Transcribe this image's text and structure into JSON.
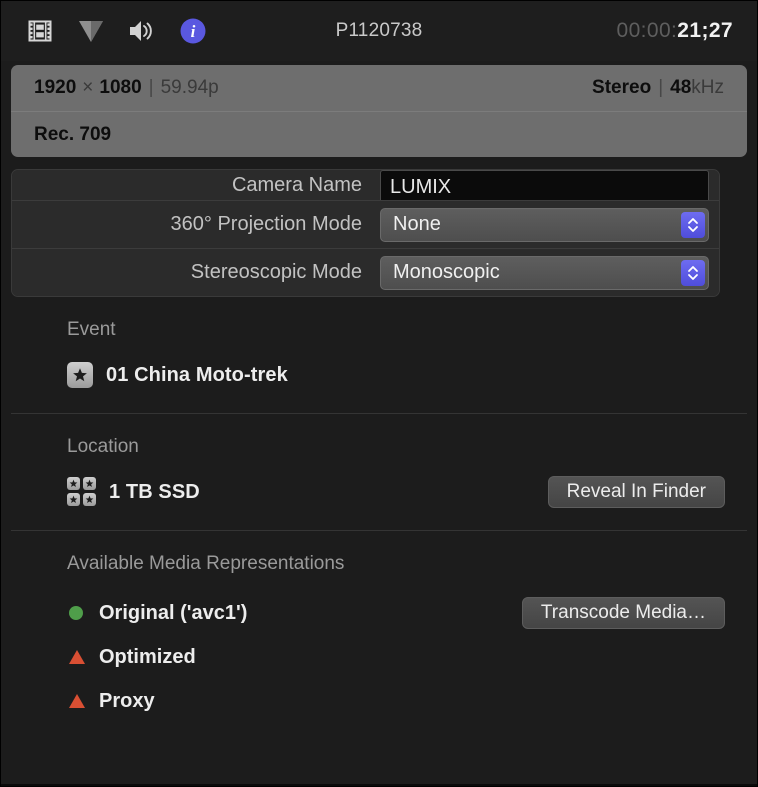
{
  "toolbar": {
    "icons": [
      {
        "name": "film-strip-icon",
        "label": "Video"
      },
      {
        "name": "filter-triangle-icon",
        "label": "Video Inspector"
      },
      {
        "name": "speaker-icon",
        "label": "Audio"
      },
      {
        "name": "info-icon",
        "label": "Info"
      }
    ],
    "clip_title": "P1120738",
    "timecode_dim": "00:00:",
    "timecode_bright": "21;27"
  },
  "info_banner": {
    "rows": [
      {
        "left": {
          "width": "1920",
          "x": "×",
          "height": "1080",
          "sep": "|",
          "framerate": "59.94p"
        },
        "right": {
          "channels": "Stereo",
          "sep": "|",
          "rate_num": "48",
          "rate_unit": "kHz"
        }
      },
      {
        "left": {
          "colorspace": "Rec. 709"
        }
      }
    ]
  },
  "properties": {
    "rows": [
      {
        "label": "Camera Name",
        "type": "text",
        "value": "LUMIX",
        "clipped": true
      },
      {
        "label": "360° Projection Mode",
        "type": "popup",
        "value": "None"
      },
      {
        "label": "Stereoscopic Mode",
        "type": "popup",
        "value": "Monoscopic"
      }
    ]
  },
  "event_section": {
    "title": "Event",
    "item_name": "01 China Moto-trek"
  },
  "location_section": {
    "title": "Location",
    "volume_name": "1 TB SSD",
    "reveal_button": "Reveal In Finder"
  },
  "media_section": {
    "title": "Available Media Representations",
    "transcode_button": "Transcode Media…",
    "items": [
      {
        "label": "Original ('avc1')",
        "status": "available",
        "marker": "dot"
      },
      {
        "label": "Optimized",
        "status": "missing",
        "marker": "triangle"
      },
      {
        "label": "Proxy",
        "status": "missing",
        "marker": "triangle"
      }
    ]
  },
  "colors": {
    "accent_blue": "#5a58e0",
    "available_green": "#4f9e4a",
    "missing_red": "#d94f33",
    "banner_gray": "#6e6e6e",
    "background": "#1c1c1c"
  }
}
